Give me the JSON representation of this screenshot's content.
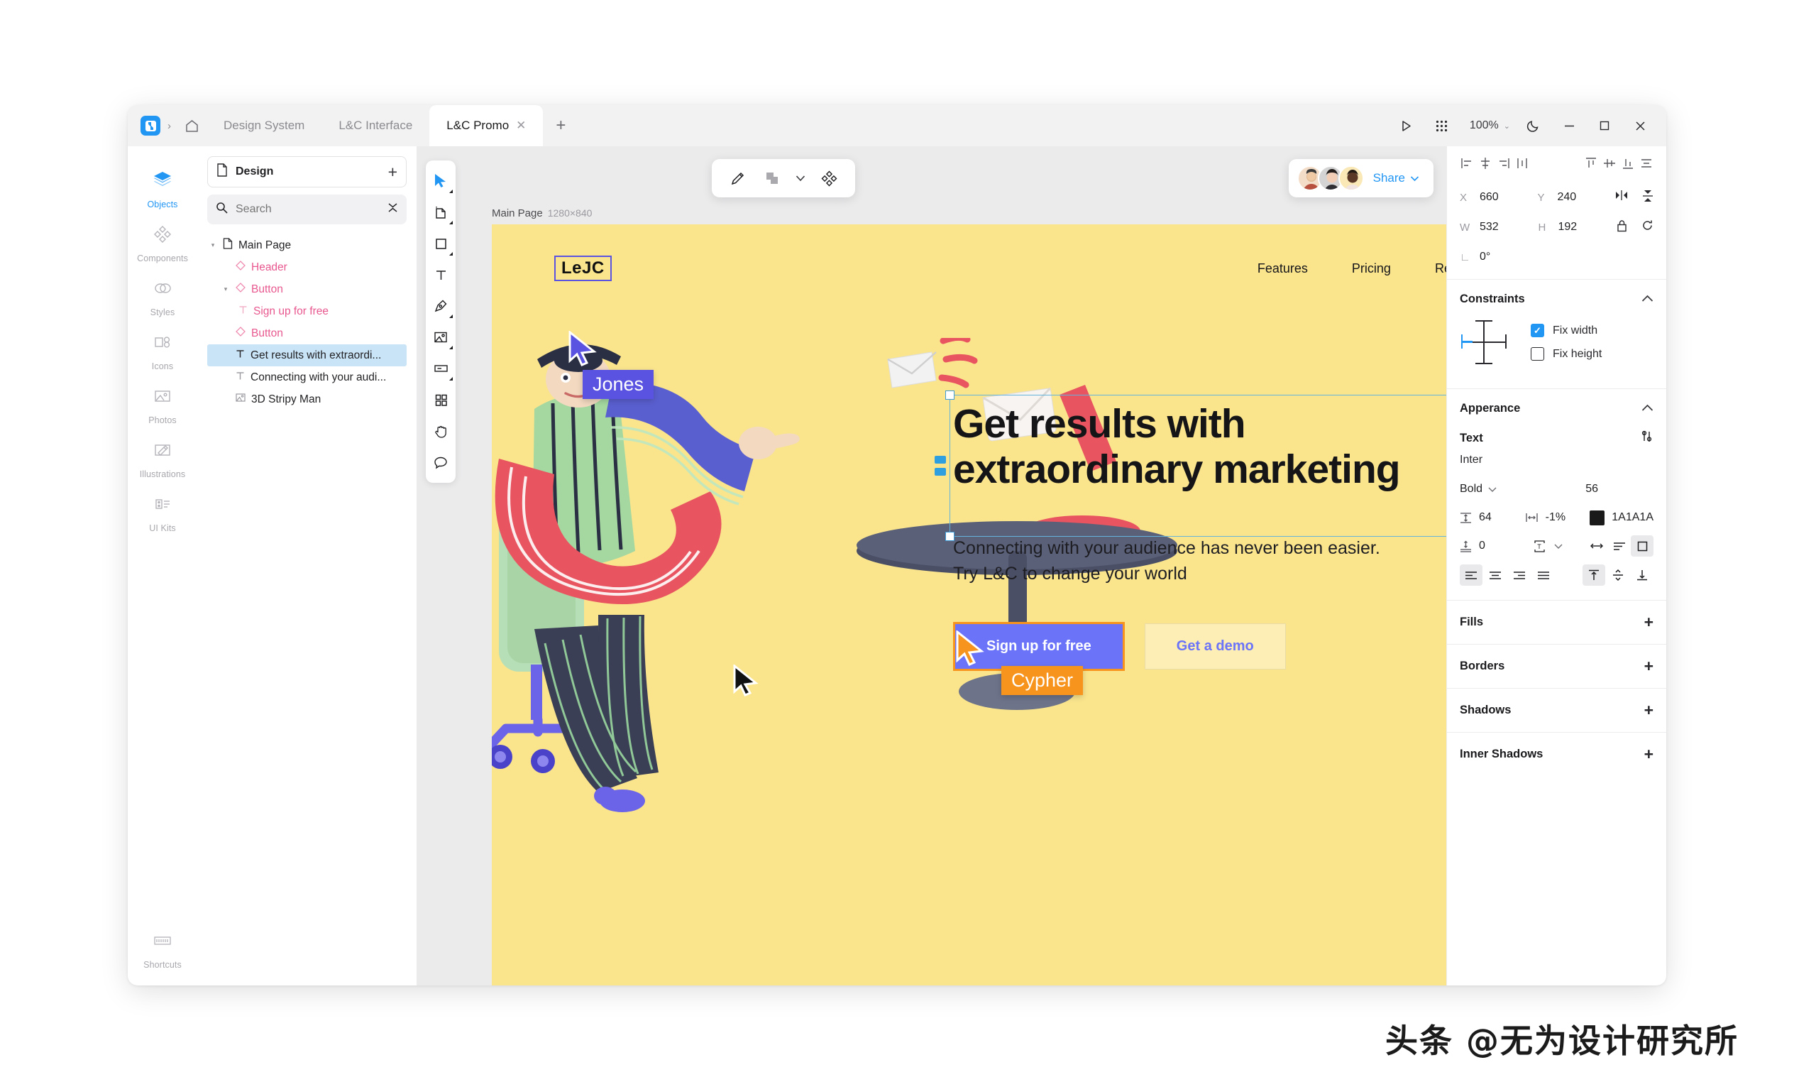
{
  "titlebar": {
    "breadcrumb_chevron": "›",
    "home_icon": "home-icon",
    "tabs": [
      {
        "label": "Design System",
        "active": false,
        "closable": false
      },
      {
        "label": "L&C Interface",
        "active": false,
        "closable": false
      },
      {
        "label": "L&C Promo",
        "active": true,
        "closable": true,
        "close_glyph": "✕"
      }
    ],
    "new_tab_glyph": "+",
    "play_icon": "play-icon",
    "grid_icon": "grid-apps-icon",
    "zoom_level": "100%",
    "zoom_chevron": "⌄",
    "theme_icon": "moon-icon",
    "minimize_glyph": "—",
    "maximize_glyph": "▢",
    "close_glyph": "✕"
  },
  "rail": {
    "items": [
      {
        "label": "Objects",
        "icon": "layers-icon",
        "active": true
      },
      {
        "label": "Components",
        "icon": "components-icon",
        "active": false
      },
      {
        "label": "Styles",
        "icon": "styles-icon",
        "active": false
      },
      {
        "label": "Icons",
        "icon": "icons-icon",
        "active": false
      },
      {
        "label": "Photos",
        "icon": "photos-icon",
        "active": false
      },
      {
        "label": "Illustrations",
        "icon": "illustrations-icon",
        "active": false
      },
      {
        "label": "UI Kits",
        "icon": "ui-kits-icon",
        "active": false
      }
    ],
    "bottom": {
      "label": "Shortcuts",
      "icon": "keyboard-icon"
    }
  },
  "layers": {
    "document_name": "Design",
    "add_glyph": "+",
    "search_placeholder": "Search",
    "tree": [
      {
        "label": "Main Page",
        "indent": 0,
        "icon": "page-icon",
        "caret": "▾",
        "color": "dark",
        "selected": false
      },
      {
        "label": "Header",
        "indent": 1,
        "icon": "component-icon",
        "caret": "",
        "color": "pink",
        "selected": false
      },
      {
        "label": "Button",
        "indent": 1,
        "icon": "component-icon",
        "caret": "▾",
        "color": "pink",
        "selected": false
      },
      {
        "label": "Sign up for free",
        "indent": 2,
        "icon": "text-icon",
        "caret": "",
        "color": "pink",
        "selected": false
      },
      {
        "label": "Button",
        "indent": 1,
        "icon": "component-icon",
        "caret": "",
        "color": "pink",
        "selected": false
      },
      {
        "label": "Get results with extraordi...",
        "indent": 1,
        "icon": "text-icon",
        "caret": "",
        "color": "dark",
        "selected": true
      },
      {
        "label": "Connecting with your audi...",
        "indent": 1,
        "icon": "text-icon",
        "caret": "",
        "color": "dark",
        "selected": false
      },
      {
        "label": "3D Stripy Man",
        "indent": 1,
        "icon": "image-icon",
        "caret": "",
        "color": "dark",
        "selected": false
      }
    ]
  },
  "toolbar": {
    "tools": [
      {
        "name": "select-tool",
        "active": true
      },
      {
        "name": "artboard-tool",
        "active": false
      },
      {
        "name": "rectangle-tool",
        "active": false
      },
      {
        "name": "text-tool",
        "active": false
      },
      {
        "name": "pen-tool",
        "active": false
      },
      {
        "name": "image-tool",
        "active": false
      },
      {
        "name": "input-field-tool",
        "active": false
      },
      {
        "name": "components-tool",
        "active": false
      },
      {
        "name": "hand-tool",
        "active": false
      },
      {
        "name": "comment-tool",
        "active": false
      }
    ]
  },
  "floatbar": {
    "pencil_icon": "pencil-icon",
    "boolean_icon": "boolean-union-icon",
    "boolean_chevron": "⌄",
    "components_icon": "components-diamond-icon"
  },
  "sharebar": {
    "avatars": [
      "avatar-1",
      "avatar-2",
      "avatar-3"
    ],
    "share_label": "Share",
    "share_chevron": "⌄"
  },
  "canvas": {
    "frame_name": "Main Page",
    "frame_dimensions": "1280×840",
    "background": "#fae58d",
    "design": {
      "logo": "LeJC",
      "nav": [
        "Features",
        "Pricing",
        "Resources"
      ],
      "headline": "Get results with extraordinary marketing",
      "subcopy": "Connecting with your audience has never been easier. Try L&C to change your world",
      "primary_button": "Sign up for free",
      "secondary_button": "Get a demo"
    },
    "cursors": [
      {
        "name": "Jones",
        "color": "#5a52e0"
      },
      {
        "name": "Cypher",
        "color": "#f7941e"
      }
    ]
  },
  "props": {
    "position": {
      "x_label": "X",
      "x_value": "660",
      "y_label": "Y",
      "y_value": "240",
      "w_label": "W",
      "w_value": "532",
      "h_label": "H",
      "h_value": "192",
      "rotation_label": "∟",
      "rotation_value": "0°",
      "flip_h_icon": "flip-horizontal-icon",
      "flip_v_icon": "flip-vertical-icon",
      "lock_icon": "lock-icon",
      "reset_icon": "reset-rotation-icon"
    },
    "constraints": {
      "title": "Constraints",
      "collapse_chevron": "⌃",
      "fix_width_label": "Fix width",
      "fix_width_checked": true,
      "fix_height_label": "Fix height",
      "fix_height_checked": false
    },
    "appearance": {
      "title": "Apperance",
      "collapse_chevron": "⌃"
    },
    "text": {
      "title": "Text",
      "settings_icon": "text-settings-icon",
      "font_family": "Inter",
      "font_weight": "Bold",
      "weight_chevron": "⌄",
      "font_size": "56",
      "line_height": "64",
      "letter_spacing": "-1%",
      "color_hex": "1A1A1A",
      "color_swatch": "#1A1A1A",
      "paragraph_spacing": "0",
      "text_case_icon": "text-case-icon",
      "case_chevron": "⌄",
      "auto_width_icon": "auto-width-icon",
      "auto_height_icon": "auto-height-icon",
      "fixed_size_icon": "fixed-size-icon",
      "h_align": [
        "align-left-icon",
        "align-center-icon",
        "align-right-icon",
        "align-justify-icon"
      ],
      "h_align_active": 0,
      "v_align": [
        "align-top-icon",
        "align-middle-icon",
        "align-bottom-icon"
      ],
      "v_align_active": 0
    },
    "sections": [
      {
        "title": "Fills",
        "add_glyph": "+"
      },
      {
        "title": "Borders",
        "add_glyph": "+"
      },
      {
        "title": "Shadows",
        "add_glyph": "+"
      },
      {
        "title": "Inner Shadows",
        "add_glyph": "+"
      }
    ]
  },
  "watermark": "头条 @无为设计研究所"
}
